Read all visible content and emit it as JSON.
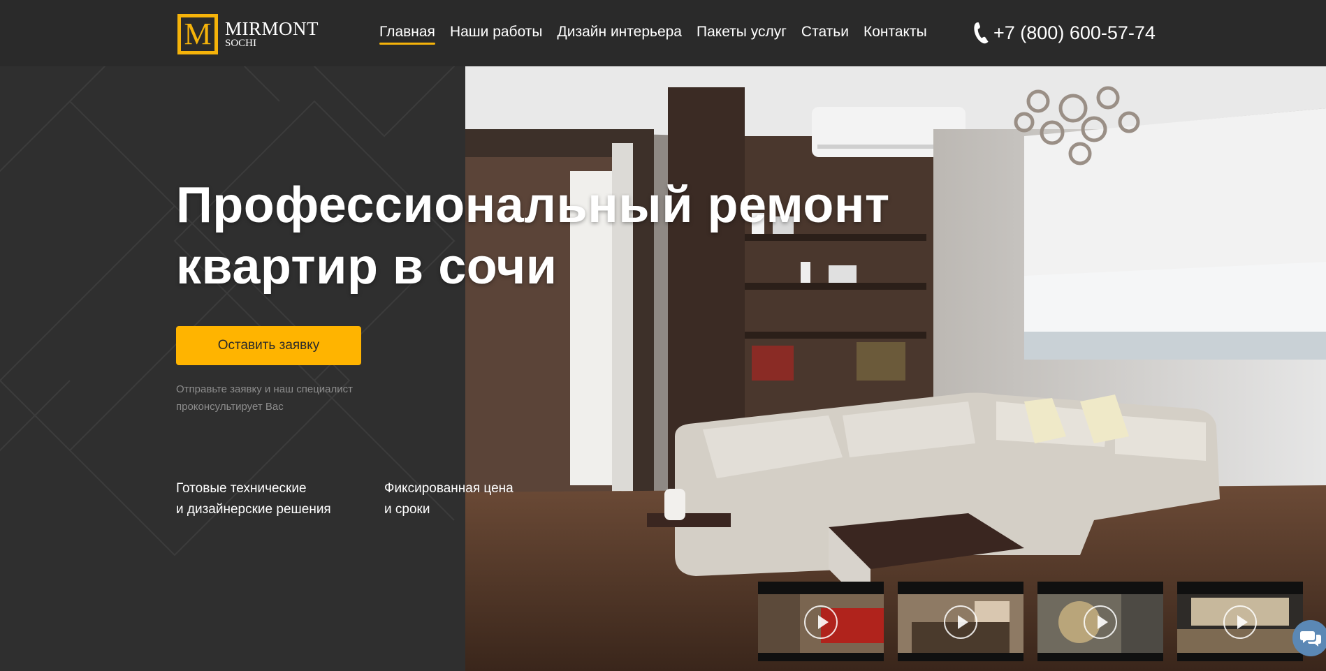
{
  "logo": {
    "mark": "M",
    "name": "MIRMONT",
    "sub": "SOCHI"
  },
  "nav": [
    {
      "label": "Главная",
      "active": true
    },
    {
      "label": "Наши работы"
    },
    {
      "label": "Дизайн интерьера"
    },
    {
      "label": "Пакеты услуг"
    },
    {
      "label": "Статьи"
    },
    {
      "label": "Контакты"
    }
  ],
  "phone": {
    "icon": "phone-icon",
    "number": "+7 (800) 600-57-74"
  },
  "hero": {
    "title_line1": "Профессиональный ремонт",
    "title_line2": "квартир в сочи",
    "cta_label": "Оставить заявку",
    "cta_note": "Отправьте заявку и наш специалист проконсультирует Вас",
    "features": [
      "Готовые технические\nи дизайнерские решения",
      "Фиксированная цена\nи сроки"
    ]
  },
  "video_thumbs": [
    {
      "icon": "play-icon"
    },
    {
      "icon": "play-icon"
    },
    {
      "icon": "play-icon"
    },
    {
      "icon": "play-icon"
    }
  ],
  "chat": {
    "icon": "chat-icon"
  },
  "colors": {
    "accent": "#ffb400",
    "header_bg": "#2a2a2a",
    "panel_bg": "#2f2f2f"
  }
}
